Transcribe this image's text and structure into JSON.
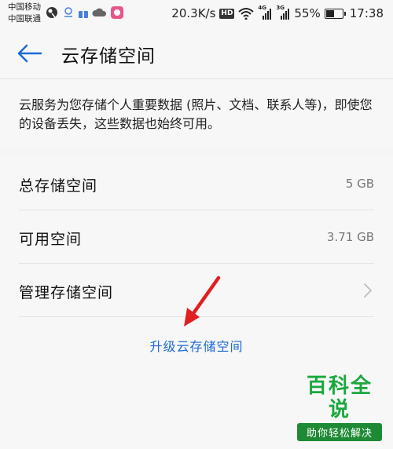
{
  "status_bar": {
    "carrier_1": "中国移动",
    "carrier_2": "中国联通",
    "speed": "20.3K/s",
    "hd": "HD",
    "net_1": "4G",
    "net_2": "3G",
    "battery": "55%",
    "battery_level": 0.55,
    "time": "17:38"
  },
  "header": {
    "title": "云存储空间",
    "accent": "#1b6ad4"
  },
  "description": "云服务为您存储个人重要数据 (照片、文档、联系人等)，即使您的设备丢失，这些数据也始终可用。",
  "rows": [
    {
      "label": "总存储空间",
      "value": "5 GB"
    },
    {
      "label": "可用空间",
      "value": "3.71 GB"
    },
    {
      "label": "管理存储空间"
    }
  ],
  "upgrade_label": "升级云存储空间",
  "watermark": {
    "title": "百科全说",
    "subtitle": "助你轻松解决"
  }
}
